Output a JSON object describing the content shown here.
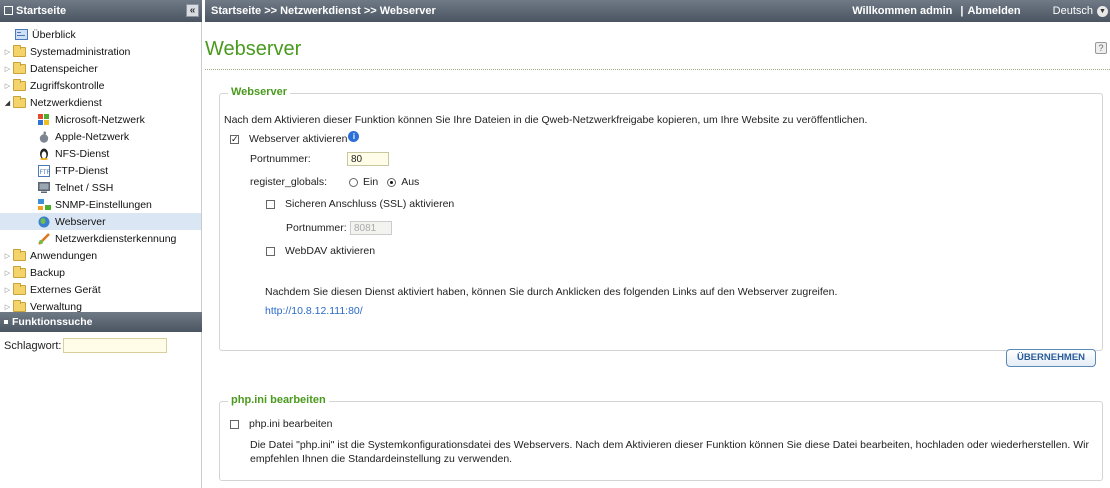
{
  "sidebar": {
    "header": "Startseite",
    "collapse_glyph": "«",
    "items": [
      {
        "label": "Überblick"
      },
      {
        "label": "Systemadministration"
      },
      {
        "label": "Datenspeicher"
      },
      {
        "label": "Zugriffskontrolle"
      },
      {
        "label": "Netzwerkdienst"
      },
      {
        "label": "Microsoft-Netzwerk"
      },
      {
        "label": "Apple-Netzwerk"
      },
      {
        "label": "NFS-Dienst"
      },
      {
        "label": "FTP-Dienst"
      },
      {
        "label": "Telnet / SSH"
      },
      {
        "label": "SNMP-Einstellungen"
      },
      {
        "label": "Webserver"
      },
      {
        "label": "Netzwerkdiensterkennung"
      },
      {
        "label": "Anwendungen"
      },
      {
        "label": "Backup"
      },
      {
        "label": "Externes Gerät"
      },
      {
        "label": "Verwaltung"
      }
    ],
    "search_header": "Funktionssuche",
    "search_label": "Schlagwort:",
    "search_value": ""
  },
  "topbar": {
    "breadcrumb": "Startseite >> Netzwerkdienst >> Webserver",
    "welcome": "Willkommen admin",
    "separator": "|",
    "logout": "Abmelden",
    "language": "Deutsch"
  },
  "main": {
    "title": "Webserver",
    "webserver_section": {
      "legend": "Webserver",
      "description": "Nach dem Aktivieren dieser Funktion können Sie Ihre Dateien in die Qweb-Netzwerkfreigabe kopieren, um Ihre Website zu veröffentlichen.",
      "enable_label": "Webserver aktivieren",
      "enable_checked": true,
      "port_label": "Portnummer:",
      "port_value": "80",
      "register_globals_label": "register_globals:",
      "radio_on_label": "Ein",
      "radio_off_label": "Aus",
      "register_globals_selected": "Aus",
      "ssl_label": "Sicheren Anschluss (SSL) aktivieren",
      "ssl_checked": false,
      "ssl_port_label": "Portnummer:",
      "ssl_port_value": "8081",
      "webdav_label": "WebDAV aktivieren",
      "webdav_checked": false,
      "access_note": "Nachdem Sie diesen Dienst aktiviert haben, können Sie durch Anklicken des folgenden Links auf den Webserver zugreifen.",
      "access_link": "http://10.8.12.111:80/"
    },
    "apply_button": "ÜBERNEHMEN",
    "phpini_section": {
      "legend": "php.ini bearbeiten",
      "edit_label": "php.ini bearbeiten",
      "edit_checked": false,
      "description_line1": "Die Datei \"php.ini\" ist die Systemkonfigurationsdatei des Webservers. Nach dem Aktivieren dieser Funktion können Sie diese Datei bearbeiten, hochladen oder wiederherstellen. Wir",
      "description_line2": "empfehlen Ihnen die Standardeinstellung zu verwenden."
    }
  },
  "colors": {
    "accent_green": "#4a9a1e",
    "header_bar": "#4a5561",
    "link_blue": "#2a6ac8",
    "selection": "#dbe6f5"
  }
}
